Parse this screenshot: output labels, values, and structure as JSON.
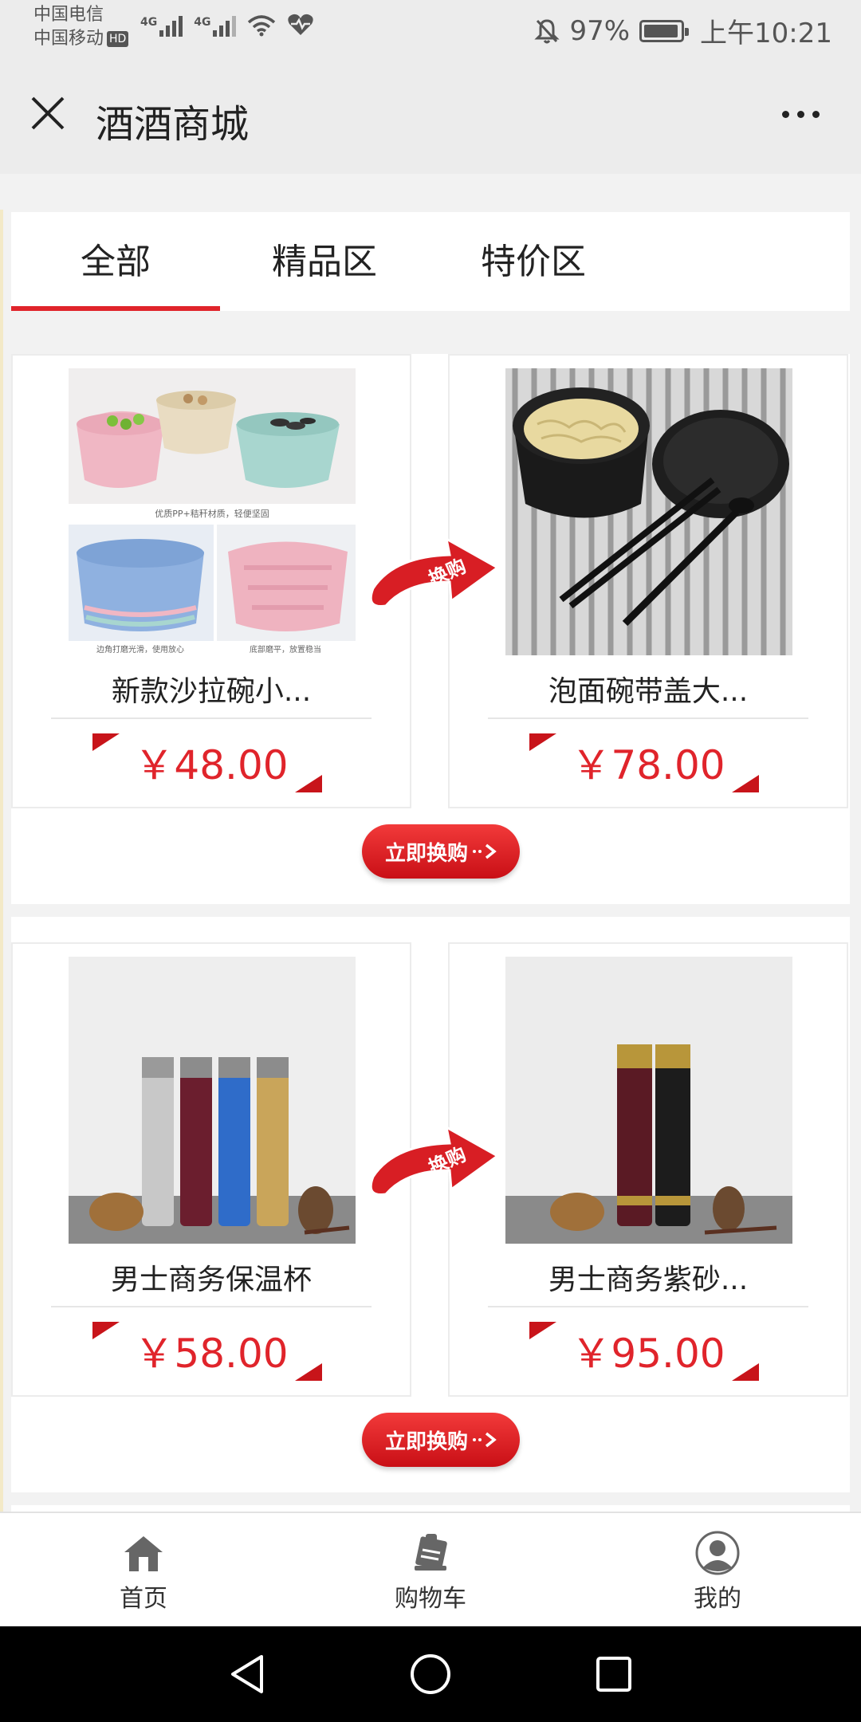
{
  "status_bar": {
    "carrier_1": "中国电信",
    "carrier_2": "中国移动",
    "hd": "HD",
    "net_1": "4G",
    "net_2": "4G",
    "battery": "97%",
    "time": "上午10:21"
  },
  "title_bar": {
    "title": "酒酒商城"
  },
  "tabs": [
    {
      "label": "全部",
      "active": true
    },
    {
      "label": "精品区",
      "active": false
    },
    {
      "label": "特价区",
      "active": false
    }
  ],
  "exchange_groups": [
    {
      "from": {
        "name": "新款沙拉碗小...",
        "price": "￥48.00"
      },
      "to": {
        "name": "泡面碗带盖大...",
        "price": "￥78.00"
      },
      "swap_label": "换购",
      "button": "立即换购"
    },
    {
      "from": {
        "name": "男士商务保温杯",
        "price": "￥58.00"
      },
      "to": {
        "name": "男士商务紫砂...",
        "price": "￥95.00"
      },
      "swap_label": "换购",
      "button": "立即换购"
    }
  ],
  "image_texts": {
    "bowl_caption_1": "优质PP+秸秆材质，轻便坚固",
    "bowl_caption_2": "边角打磨光滑，使用放心",
    "bowl_caption_3": "底部磨平，放置稳当"
  },
  "bottom_nav": [
    {
      "label": "首页",
      "icon": "home-icon"
    },
    {
      "label": "购物车",
      "icon": "cart-icon"
    },
    {
      "label": "我的",
      "icon": "profile-icon"
    }
  ],
  "colors": {
    "accent": "#e0242b",
    "price": "#e0242b"
  }
}
